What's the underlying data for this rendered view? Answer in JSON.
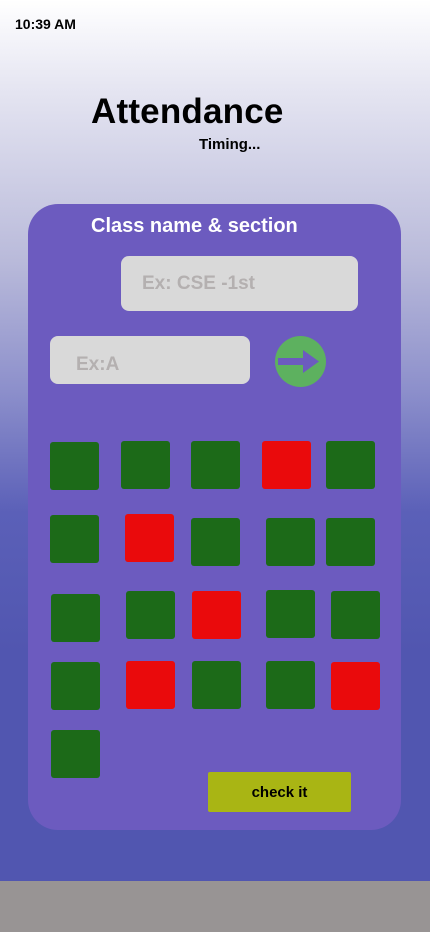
{
  "status_bar": {
    "time": "10:39  AM"
  },
  "header": {
    "title": "Attendance",
    "subtitle": "Timing..."
  },
  "form": {
    "card_title": "Class name & section",
    "class_placeholder": "Ex: CSE -1st",
    "section_placeholder": "Ex:A",
    "go_icon": "arrow-right-icon",
    "check_label": "check it"
  },
  "attendance": [
    {
      "status": "present"
    },
    {
      "status": "present"
    },
    {
      "status": "present"
    },
    {
      "status": "absent"
    },
    {
      "status": "present"
    },
    {
      "status": "present"
    },
    {
      "status": "absent"
    },
    {
      "status": "present"
    },
    {
      "status": "present"
    },
    {
      "status": "present"
    },
    {
      "status": "present"
    },
    {
      "status": "present"
    },
    {
      "status": "absent"
    },
    {
      "status": "present"
    },
    {
      "status": "present"
    },
    {
      "status": "present"
    },
    {
      "status": "absent"
    },
    {
      "status": "present"
    },
    {
      "status": "present"
    },
    {
      "status": "absent"
    },
    {
      "status": "present"
    }
  ],
  "colors": {
    "card": "#6c5bbf",
    "present": "#1c6a18",
    "absent": "#ea0a0c",
    "go_button": "#5db15f",
    "check_button": "#a9b514",
    "bottom_bar": "#989494"
  }
}
